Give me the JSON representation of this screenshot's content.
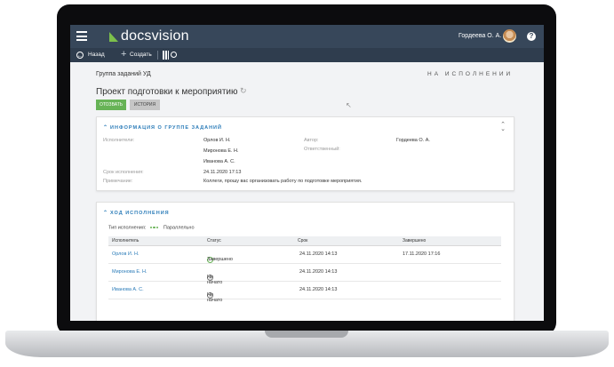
{
  "header": {
    "logo_text": "docsvision",
    "user_name": "Гордеева О. А.",
    "help_symbol": "?"
  },
  "toolbar": {
    "back_label": "Назад",
    "create_label": "Создать"
  },
  "page": {
    "group_title": "Группа заданий УД",
    "status": "НА ИСПОЛНЕНИИ",
    "title": "Проект подготовки к мероприятию",
    "recall_button": "ОТОЗВАТЬ",
    "history_button": "ИСТОРИЯ"
  },
  "info_section": {
    "header": "ИНФОРМАЦИЯ О ГРУППЕ ЗАДАНИЙ",
    "executors_label": "Исполнители:",
    "executors": [
      "Орлов И. Н.",
      "Миронова Е. Н.",
      "Иванова А. С."
    ],
    "author_label": "Автор:",
    "author": "Гордеева О. А.",
    "responsible_label": "Ответственный:",
    "due_label": "Срок исполнения:",
    "due": "24.11.2020 17:13",
    "note_label": "Примечание:",
    "note": "Коллеги, прошу вас организовать работу по подготовке мероприятия."
  },
  "progress_section": {
    "header": "ХОД ИСПОЛНЕНИЯ",
    "type_label": "Тип исполнения:",
    "type_value": "Параллельно",
    "columns": [
      "Исполнитель",
      "Статус",
      "Срок",
      "Завершено"
    ],
    "rows": [
      {
        "executor": "Орлов И. Н.",
        "status": "Завершено",
        "due": "24.11.2020 14:13",
        "completed": "17.11.2020 17:16"
      },
      {
        "executor": "Миронова Е. Н.",
        "status": "Не начато",
        "due": "24.11.2020 14:13",
        "completed": ""
      },
      {
        "executor": "Иванова А. С.",
        "status": "Не начато",
        "due": "24.11.2020 14:13",
        "completed": ""
      }
    ]
  },
  "colors": {
    "header_bg": "#37475a",
    "accent_green": "#67b356",
    "link_blue": "#2a7bb8"
  },
  "icons": [
    "menu-icon",
    "docsvision-logo",
    "avatar",
    "help-icon",
    "back-icon",
    "plus-icon",
    "barcode-search-icon",
    "refresh-icon",
    "chevron-up-icon",
    "collapse-icon",
    "parallel-icon",
    "check-circle-icon",
    "clock-icon"
  ]
}
